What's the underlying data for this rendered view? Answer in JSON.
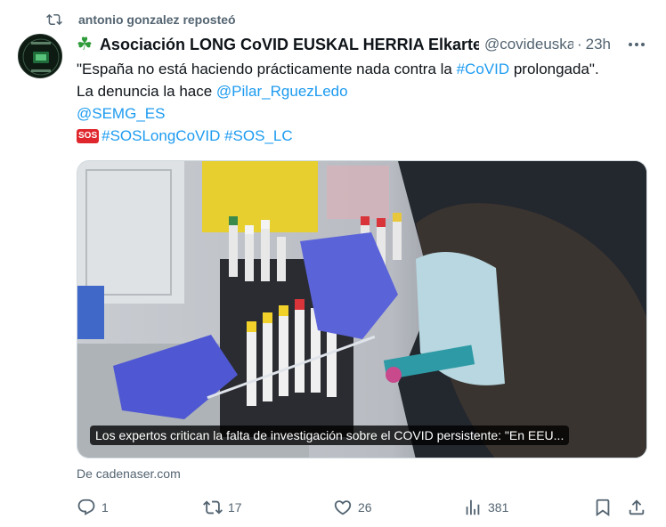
{
  "repost": {
    "text": "antonio gonzalez reposteó",
    "icon": "repost-icon"
  },
  "author": {
    "display_name": "Asociación LONG CoVID EUSKAL HERRIA Elkartea",
    "handle": "@covideuskadi",
    "time": "23h",
    "emoji": "four-leaf-clover"
  },
  "tweet": {
    "line1_pre": "\"España no está haciendo prácticamente nada contra la ",
    "line1_tag": "#CoVID",
    "line1_post": " prolongada\".",
    "line2_pre": "La denuncia la hace ",
    "line2_mention": "@Pilar_RguezLedo",
    "line3_mention": "@SEMG_ES",
    "sos_badge": "SOS",
    "line4_tags": "#SOSLongCoVID #SOS_LC"
  },
  "card": {
    "caption": "Los expertos critican la falta de investigación sobre el COVID persistente: \"En EEU...",
    "source": "De cadenaser.com"
  },
  "actions": {
    "replies": "1",
    "reposts": "17",
    "likes": "26",
    "views": "381"
  },
  "colors": {
    "link": "#1d9bf0",
    "muted": "#536471",
    "text": "#0f1419"
  }
}
